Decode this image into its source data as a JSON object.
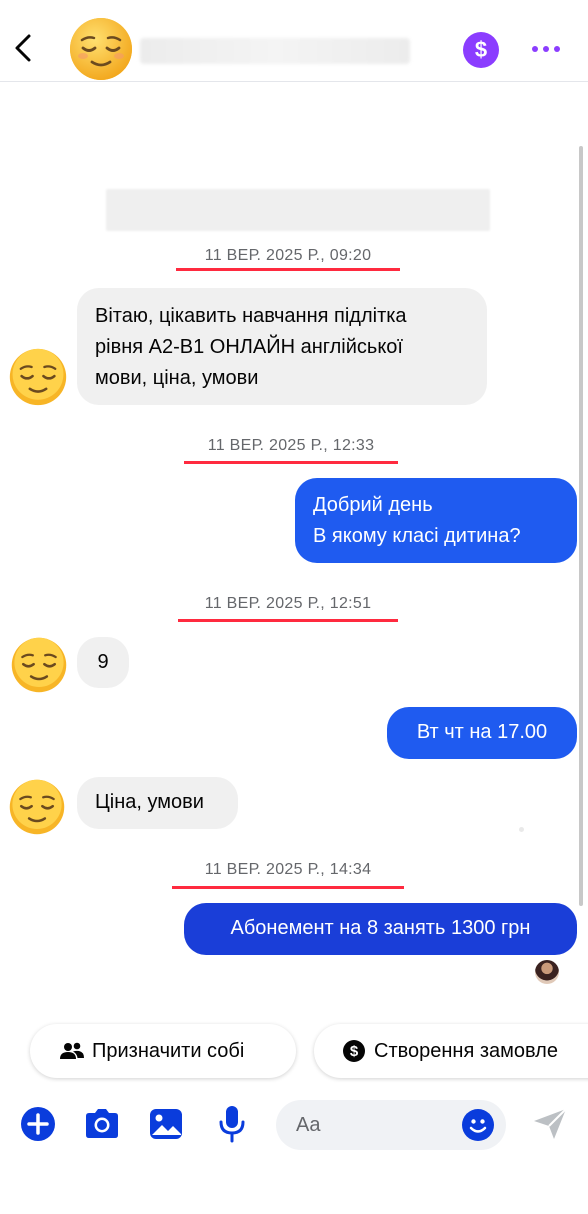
{
  "header": {
    "contact_emoji": "😌",
    "pay_symbol": "$"
  },
  "messages": [
    {
      "type": "timestamp",
      "text": "11 ВЕР. 2025 Р., 09:20"
    },
    {
      "type": "incoming",
      "lines": [
        "Вітаю, цікавить навчання підлітка",
        "рівня А2-В1 ОНЛАЙН англійської",
        "мови, ціна, умови"
      ]
    },
    {
      "type": "timestamp",
      "text": "11 ВЕР. 2025 Р., 12:33"
    },
    {
      "type": "outgoing",
      "lines": [
        "Добрий день",
        "В якому класі дитина?"
      ]
    },
    {
      "type": "timestamp",
      "text": "11 ВЕР. 2025 Р., 12:51"
    },
    {
      "type": "incoming",
      "lines": [
        "9"
      ]
    },
    {
      "type": "outgoing",
      "lines": [
        "Вт чт на 17.00"
      ]
    },
    {
      "type": "incoming",
      "lines": [
        "Ціна, умови"
      ]
    },
    {
      "type": "timestamp",
      "text": "11 ВЕР. 2025 Р., 14:34"
    },
    {
      "type": "outgoing",
      "lines": [
        "Абонемент на 8 занять 1300 грн"
      ]
    }
  ],
  "colors": {
    "outgoing_bubble": "#1f5bf0",
    "outgoing_bubble_last": "#1a3ed8",
    "incoming_bubble": "#f0f0f0",
    "timestamp_underline": "#ff2a3f",
    "accent": "#0a3cdc",
    "purple": "#8b3dff"
  },
  "quick_actions": [
    {
      "label": "Призначити собі",
      "icon": "people-icon"
    },
    {
      "label": "Створення замовле",
      "icon": "dollar-circle-icon"
    }
  ],
  "composer": {
    "placeholder": "Aa"
  }
}
